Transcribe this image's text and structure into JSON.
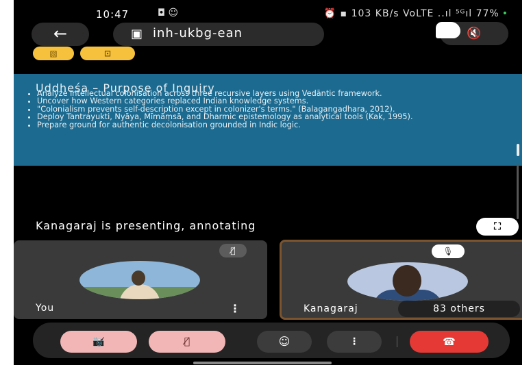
{
  "status_bar": {
    "time": "10:47",
    "left_icons": "◘ ☺",
    "right_text": "⏰ ▪ 103 KB/s  VoLTE ..ıl  ⁵ᴳıl 77%",
    "battery_dot": "•"
  },
  "header": {
    "back_icon": "←",
    "calendar_icon": "▣",
    "meeting_code": "inh-ukbg-ean",
    "speaker_icon": "🔇"
  },
  "chips": {
    "chip1": "▧",
    "chip2": "⊡"
  },
  "slide": {
    "title": "Uddheśa – Purpose of Inquiry",
    "bullets": [
      "Analyze intellectual colonisation across three recursive layers using Vedāntic framework.",
      "Uncover how Western categories replaced Indian knowledge systems.",
      "\"Colonialism prevents self-description except in colonizer's terms.\" (Balagangadhara, 2012).",
      "Deploy Tantrayukti, Nyāya, Mīmāṃsā, and Dharmic epistemology as analytical tools (Kak, 1995).",
      "Prepare ground for authentic decolonisation grounded in Indic logic."
    ]
  },
  "presenting_text": "Kanagaraj is presenting, annotating",
  "fullscreen_icon": "⛶",
  "tiles": {
    "you": {
      "name": "You",
      "mic_icon": "🎙̸",
      "more_icon": "⋮"
    },
    "presenter": {
      "name": "Kanagaraj",
      "mic_icon": "🎙",
      "others": "83 others"
    }
  },
  "controls": {
    "camera_icon": "📷̸",
    "mic_icon": "🎙̸",
    "emoji_icon": "☺",
    "more_icon": "⋮",
    "end_call_icon": "☎"
  },
  "colors": {
    "slide_bg": "#1c6a8f",
    "chip": "#f6c23e",
    "end_call": "#e53935",
    "muted_control": "#f3b6b6"
  }
}
